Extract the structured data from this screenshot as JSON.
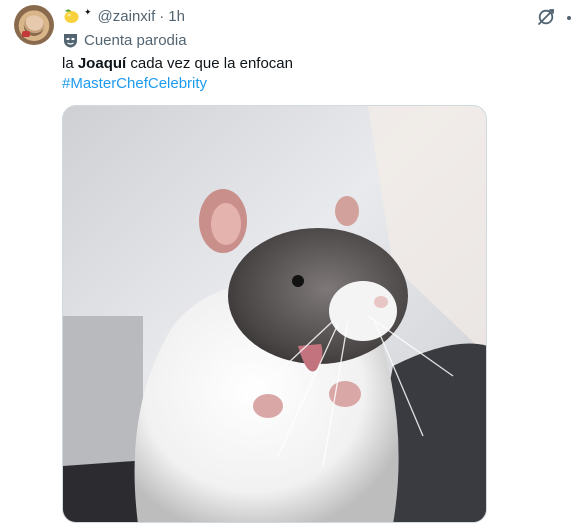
{
  "tweet": {
    "handle": "@zainxif",
    "separator": "·",
    "time": "1h",
    "parody_label": "Cuenta parodia",
    "text_prefix": "la ",
    "text_bold": "Joaquí",
    "text_suffix": " cada vez que la enfocan",
    "hashtag": "#MasterChefCelebrity"
  },
  "icons": {
    "display_name_emoji": "lemon-icon",
    "badge": "star-icon",
    "parody": "mask-icon",
    "header_action": "grok-icon",
    "more": "dots-icon"
  },
  "colors": {
    "link": "#1d9bf0",
    "secondary_text": "#536471",
    "primary_text": "#0f1419"
  }
}
